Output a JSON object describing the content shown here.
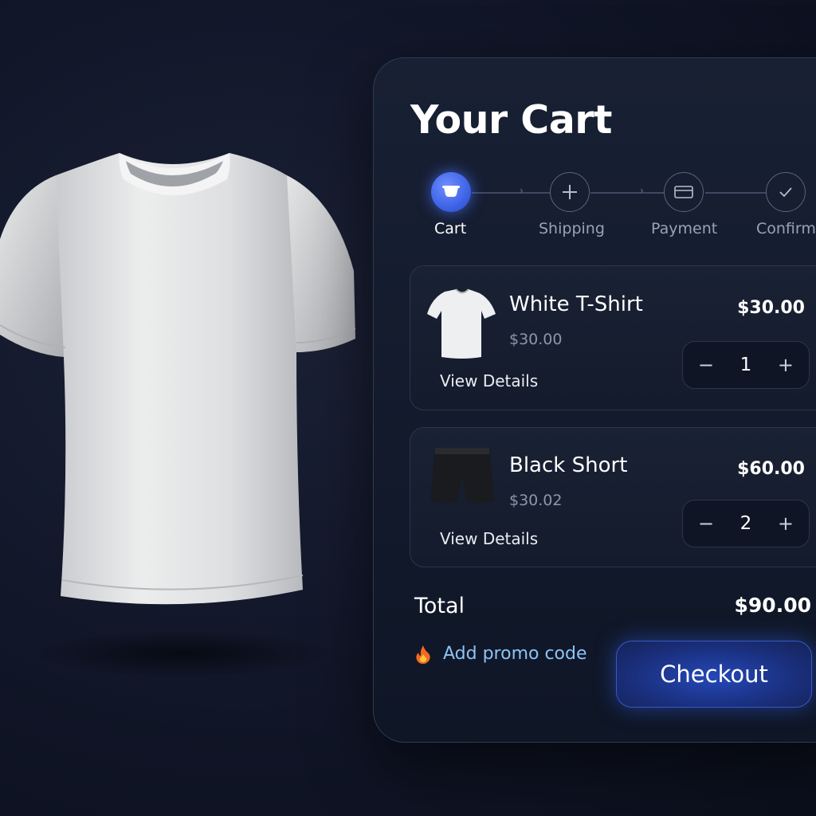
{
  "cart": {
    "title": "Your Cart",
    "steps": [
      {
        "label": "Cart",
        "icon": "cart-icon",
        "active": true
      },
      {
        "label": "Shipping",
        "icon": "plus-icon",
        "active": false
      },
      {
        "label": "Payment",
        "icon": "card-icon",
        "active": false
      },
      {
        "label": "Confirm",
        "icon": "check-icon",
        "active": false
      }
    ],
    "items": [
      {
        "name": "White T-Shirt",
        "unit_price": "$30.00",
        "line_total": "$30.00",
        "quantity": "1",
        "details_label": "View Details",
        "thumbnail": "white-tshirt-thumbnail"
      },
      {
        "name": "Black Short",
        "unit_price": "$30.02",
        "line_total": "$60.00",
        "quantity": "2",
        "details_label": "View Details",
        "thumbnail": "black-short-thumbnail"
      }
    ],
    "total_label": "Total",
    "total_value": "$90.00",
    "promo_label": "Add promo code",
    "checkout_label": "Checkout"
  },
  "colors": {
    "background": "#12172a",
    "accent": "#3e63e6",
    "promo_link": "#8cc3f5"
  }
}
